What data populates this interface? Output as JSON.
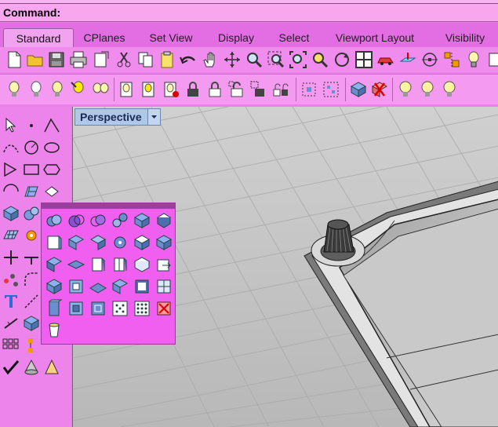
{
  "command": {
    "prompt": "Command:"
  },
  "tabs": [
    {
      "label": "Standard",
      "active": true
    },
    {
      "label": "CPlanes",
      "active": false
    },
    {
      "label": "Set View",
      "active": false
    },
    {
      "label": "Display",
      "active": false
    },
    {
      "label": "Select",
      "active": false
    },
    {
      "label": "Viewport Layout",
      "active": false
    },
    {
      "label": "Visibility",
      "active": false
    }
  ],
  "viewport": {
    "title": "Perspective"
  },
  "toolbar_top_icons": [
    "new-file",
    "open-folder",
    "save",
    "print",
    "import",
    "cut",
    "copy",
    "paste",
    "undo",
    "pan-hand",
    "rotate-view",
    "zoom",
    "zoom-window",
    "zoom-extents",
    "zoom-selected",
    "rotate-camera",
    "four-viewports",
    "car-properties",
    "cplane",
    "grid-options",
    "more-tools",
    "light-bulb"
  ],
  "toolbar_second_icons": [
    "light-on",
    "light-off",
    "light-bulb-a",
    "light-select",
    "light-pair",
    "properties-doc",
    "layer-doc",
    "lock-doc",
    "lock",
    "lock-open",
    "unlock",
    "unlock-select",
    "group-lock",
    "match-props",
    "block-cross",
    "bulb-a",
    "bulb-b",
    "bulb-c"
  ],
  "colors": {
    "accent": "#ec7fec",
    "viewport_bg": "#c8c8c8",
    "viewport_tab": "#afc7e8"
  }
}
